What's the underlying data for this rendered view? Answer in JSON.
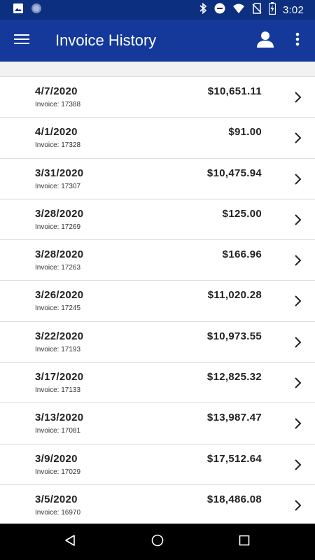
{
  "status_bar": {
    "time": "3:02",
    "left_icons": [
      "image-icon",
      "sync-icon"
    ],
    "right_icons": [
      "bluetooth-icon",
      "do-not-disturb-icon",
      "wifi-icon",
      "no-sim-icon",
      "battery-charging-icon"
    ]
  },
  "app_bar": {
    "title": "Invoice History",
    "icons": [
      "menu-icon",
      "account-icon",
      "more-vert-icon"
    ]
  },
  "invoices": [
    {
      "date": "4/7/2020",
      "invoice": "Invoice: 17388",
      "amount": "$10,651.11"
    },
    {
      "date": "4/1/2020",
      "invoice": "Invoice: 17328",
      "amount": "$91.00"
    },
    {
      "date": "3/31/2020",
      "invoice": "Invoice: 17307",
      "amount": "$10,475.94"
    },
    {
      "date": "3/28/2020",
      "invoice": "Invoice: 17269",
      "amount": "$125.00"
    },
    {
      "date": "3/28/2020",
      "invoice": "Invoice: 17263",
      "amount": "$166.96"
    },
    {
      "date": "3/26/2020",
      "invoice": "Invoice: 17245",
      "amount": "$11,020.28"
    },
    {
      "date": "3/22/2020",
      "invoice": "Invoice: 17193",
      "amount": "$10,973.55"
    },
    {
      "date": "3/17/2020",
      "invoice": "Invoice: 17133",
      "amount": "$12,825.32"
    },
    {
      "date": "3/13/2020",
      "invoice": "Invoice: 17081",
      "amount": "$13,987.47"
    },
    {
      "date": "3/9/2020",
      "invoice": "Invoice: 17029",
      "amount": "$17,512.64"
    },
    {
      "date": "3/5/2020",
      "invoice": "Invoice: 16970",
      "amount": "$18,486.08"
    }
  ],
  "nav_bar": {
    "icons": [
      "back-icon",
      "home-icon",
      "recents-icon"
    ]
  },
  "colors": {
    "status_bar": "#0d2f80",
    "app_bar": "#14399a",
    "background": "#f2f2f2",
    "nav_bar": "#000000"
  }
}
